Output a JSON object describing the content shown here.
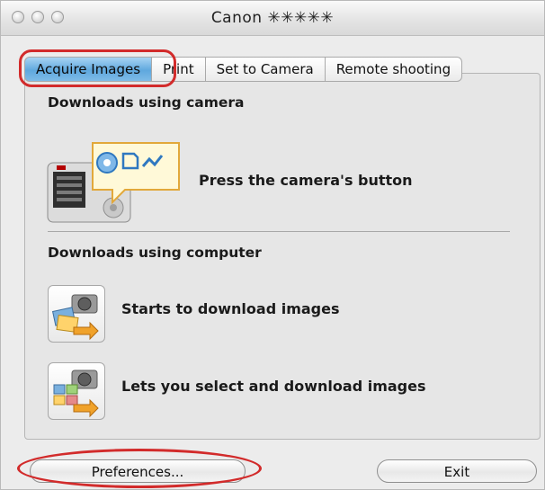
{
  "window": {
    "title": "Canon ✳✳✳✳✳"
  },
  "tabs": [
    {
      "label": "Acquire Images",
      "active": true
    },
    {
      "label": "Print",
      "active": false
    },
    {
      "label": "Set to Camera",
      "active": false
    },
    {
      "label": "Remote shooting",
      "active": false
    }
  ],
  "sections": {
    "camera": {
      "heading": "Downloads using camera",
      "items": [
        {
          "icon": "camera-button-icon",
          "label": "Press the camera's button"
        }
      ]
    },
    "computer": {
      "heading": "Downloads using computer",
      "items": [
        {
          "icon": "download-images-icon",
          "label": "Starts to download images"
        },
        {
          "icon": "select-download-icon",
          "label": "Lets you select and download images"
        }
      ]
    }
  },
  "buttons": {
    "preferences": "Preferences...",
    "exit": "Exit"
  },
  "colors": {
    "accent_tab": "#5fa8de",
    "annotation": "#d22b2b"
  }
}
